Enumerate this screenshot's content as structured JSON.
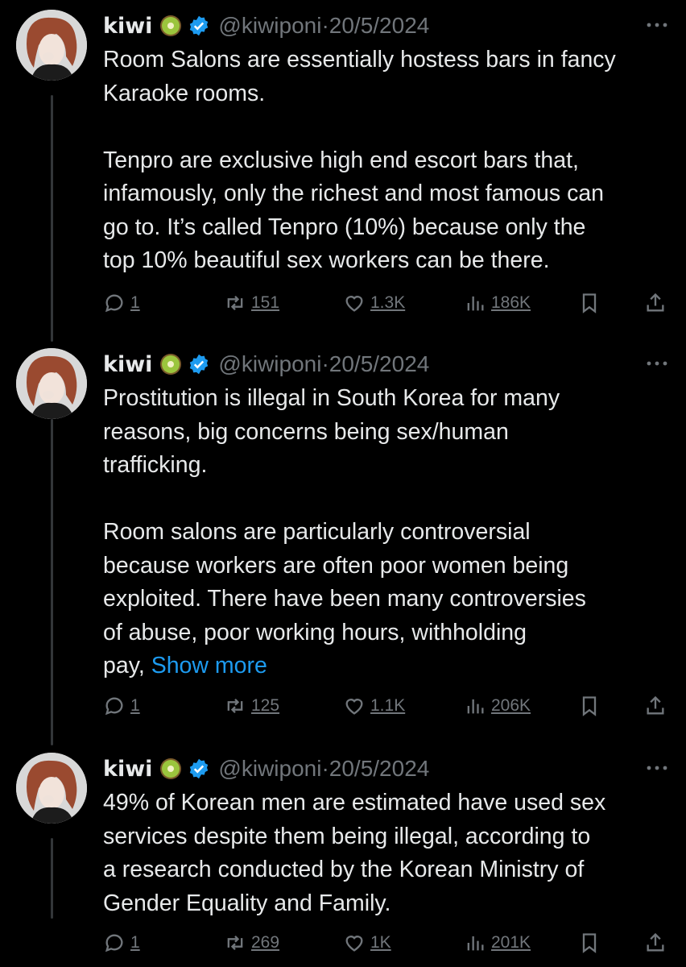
{
  "tweets": [
    {
      "name": "kiwi",
      "handle": "@kiwiponi",
      "date": "20/5/2024",
      "paragraphs": [
        [
          "Room Salons are essentially hostess bars in fancy",
          "Karaoke rooms."
        ],
        [
          "Tenpro are exclusive high end escort bars that,",
          "infamously, only the richest and most famous can",
          "go to. It’s called Tenpro (10%) because only the",
          "top 10% beautiful sex workers can be there."
        ]
      ],
      "replies": "1",
      "retweets": "151",
      "likes": "1.3K",
      "views": "186K"
    },
    {
      "name": "kiwi",
      "handle": "@kiwiponi",
      "date": "20/5/2024",
      "paragraphs": [
        [
          "Prostitution is illegal in South Korea for many",
          "reasons, big concerns being sex/human",
          "trafficking."
        ],
        [
          "Room salons are particularly controversial",
          "because workers are often poor women being",
          "exploited. There have been many controversies",
          "of abuse, poor working hours, withholding",
          "pay,"
        ]
      ],
      "show_more": "Show more",
      "replies": "1",
      "retweets": "125",
      "likes": "1.1K",
      "views": "206K"
    },
    {
      "name": "kiwi",
      "handle": "@kiwiponi",
      "date": "20/5/2024",
      "paragraphs": [
        [
          "49% of Korean men are estimated have used sex",
          "services despite them being illegal, according to",
          "a research conducted by the Korean Ministry of",
          "Gender Equality and Family."
        ]
      ],
      "replies": "1",
      "retweets": "269",
      "likes": "1K",
      "views": "201K"
    }
  ],
  "colors": {
    "background": "#000000",
    "text": "#e7e9ea",
    "muted": "#71767b",
    "link": "#1d9bf0",
    "verified": "#1d9bf0"
  }
}
